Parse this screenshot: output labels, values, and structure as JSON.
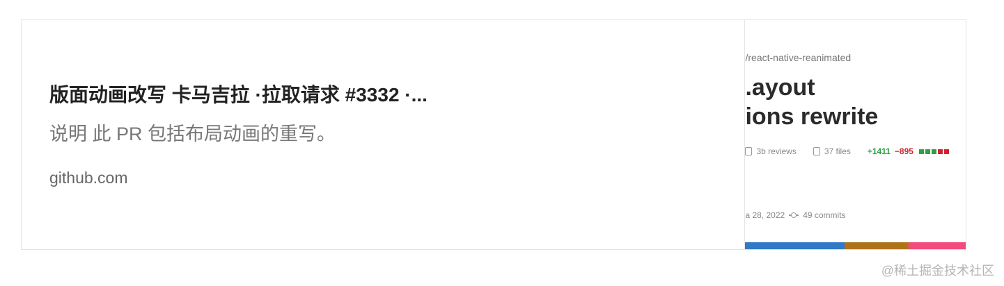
{
  "card": {
    "title": "版面动画改写 卡马吉拉 ·拉取请求 #3332 ·...",
    "description": "说明 此 PR 包括布局动画的重写。",
    "domain": "github.com"
  },
  "thumbnail": {
    "repo": "/react-native-reanimated",
    "title_line1": ".ayout",
    "title_line2": "ions rewrite",
    "reviews": "3b reviews",
    "files": "37 files",
    "additions": "+1411",
    "deletions": "−895",
    "date": "a 28, 2022",
    "commits": "49 commits",
    "lang_colors": [
      "#3178c6",
      "#b07219",
      "#f34b7d"
    ],
    "lang_shares": [
      0.45,
      0.29,
      0.26
    ]
  },
  "watermark": "@稀土掘金技术社区",
  "colors": {
    "additions": "#2ea043",
    "deletions": "#d1242f"
  }
}
